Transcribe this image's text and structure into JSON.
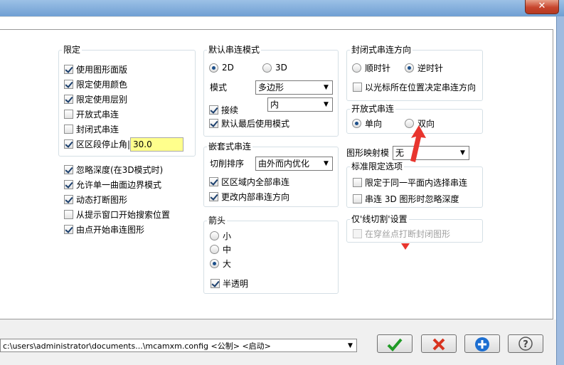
{
  "window": {
    "close_glyph": "✕"
  },
  "group_limit": {
    "title": "限定",
    "items": [
      {
        "label": "使用图形面版",
        "checked": true
      },
      {
        "label": "限定使用颜色",
        "checked": true
      },
      {
        "label": "限定使用层别",
        "checked": true
      },
      {
        "label": "开放式串连",
        "checked": false
      },
      {
        "label": "封闭式串连",
        "checked": false
      },
      {
        "label": "区区段停止角|",
        "checked": true
      }
    ],
    "angle_value": "30.0"
  },
  "options_left": [
    {
      "label": "忽略深度(在3D模式时)",
      "checked": true
    },
    {
      "label": "允许单一曲面边界模式",
      "checked": true
    },
    {
      "label": "动态打断图形",
      "checked": true
    },
    {
      "label": "从提示窗口开始搜索位置",
      "checked": false
    },
    {
      "label": "由点开始串连图形",
      "checked": true
    }
  ],
  "group_default": {
    "title": "默认串连模式",
    "radio_2d": "2D",
    "radio_3d": "3D",
    "mode_label": "模式",
    "mode_value": "多边形",
    "continue_label": "接续",
    "continue_value": "内",
    "default_last_label": "默认最后使用模式"
  },
  "group_nested": {
    "title": "嵌套式串连",
    "cut_order_label": "切削排序",
    "cut_order_value": "由外而内优化",
    "all_in_region": "区区域内全部串连",
    "change_direction": "更改内部串连方向"
  },
  "group_arrow": {
    "title": "箭头",
    "small": "小",
    "medium": "中",
    "large": "大",
    "translucent": "半透明"
  },
  "group_closed_dir": {
    "title": "封闭式串连方向",
    "cw": "顺时针",
    "ccw": "逆时针",
    "cursor_dir": "以光标所在位置决定串连方向"
  },
  "group_open": {
    "title": "开放式串连",
    "single": "单向",
    "double": "双向"
  },
  "mapping": {
    "label": "图形映射模",
    "value": "无"
  },
  "group_standard": {
    "title": "标准限定选项",
    "same_plane": "限定于同一平面内选择串连",
    "ignore_depth": "串连 3D 图形时忽略深度"
  },
  "group_wire": {
    "title": "仅'线切割'设置",
    "break_closed": "在穿丝点打断封闭图形"
  },
  "footer": {
    "config_path": "c:\\users\\administrator\\documents...\\mcamxm.config <公制> <启动>"
  },
  "colors": {
    "arrow_red": "#e8352e",
    "highlight_field": "#ffff8c"
  }
}
